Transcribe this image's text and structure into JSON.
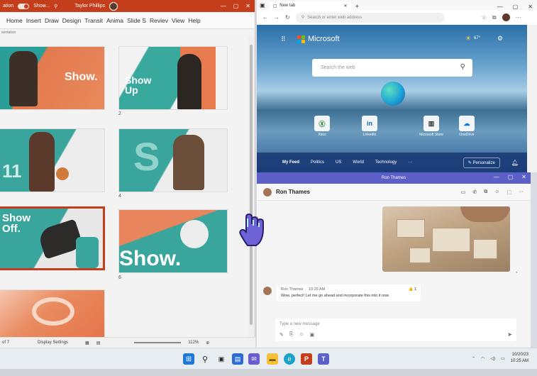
{
  "powerpoint": {
    "title_filename": "ation",
    "title_toggle_label": "On",
    "title_file": "Show...",
    "title_user": "Taylor Phillips",
    "tabs": [
      "Home",
      "Insert",
      "Draw",
      "Design",
      "Transit",
      "Anima",
      "Slide S",
      "Reviev",
      "View",
      "Help"
    ],
    "section_label": "sentation",
    "slides": [
      {
        "number": "",
        "text": "Show."
      },
      {
        "number": "2",
        "text": "Show Up"
      },
      {
        "number": "",
        "text": "11"
      },
      {
        "number": "4",
        "text": "S"
      },
      {
        "number": "",
        "text": "Show Off."
      },
      {
        "number": "6",
        "text": "Show."
      },
      {
        "number": "",
        "text": ""
      }
    ],
    "status": {
      "slide_count": "of 7",
      "display_settings": "Display Settings",
      "zoom": "112%"
    },
    "accent": "#c43e1c"
  },
  "edge": {
    "tab_title": "New tab",
    "address_placeholder": "Search or enter web address",
    "brand": "Microsoft",
    "weather": "67°",
    "search_placeholder": "Search the web",
    "quick_links": [
      "Xbox",
      "LinkedIn",
      "Microsoft Store",
      "OneDrive"
    ],
    "feed_tabs": [
      "My Feed",
      "Politics",
      "US",
      "World",
      "Technology",
      "···"
    ],
    "personalize": "Personalize"
  },
  "teams": {
    "window_title": "Ron Thames",
    "contact": "Ron Thames",
    "message": {
      "sender": "Ron Thames",
      "time": "10:25 AM",
      "text": "Wow, perfect! Let me go ahead and incorporate this into it now",
      "reaction": "👍 1"
    },
    "compose_placeholder": "Type a new message",
    "accent": "#5b5fc7"
  },
  "taskbar": {
    "clock_time": "10:25 AM",
    "clock_date": "10/20/23"
  }
}
